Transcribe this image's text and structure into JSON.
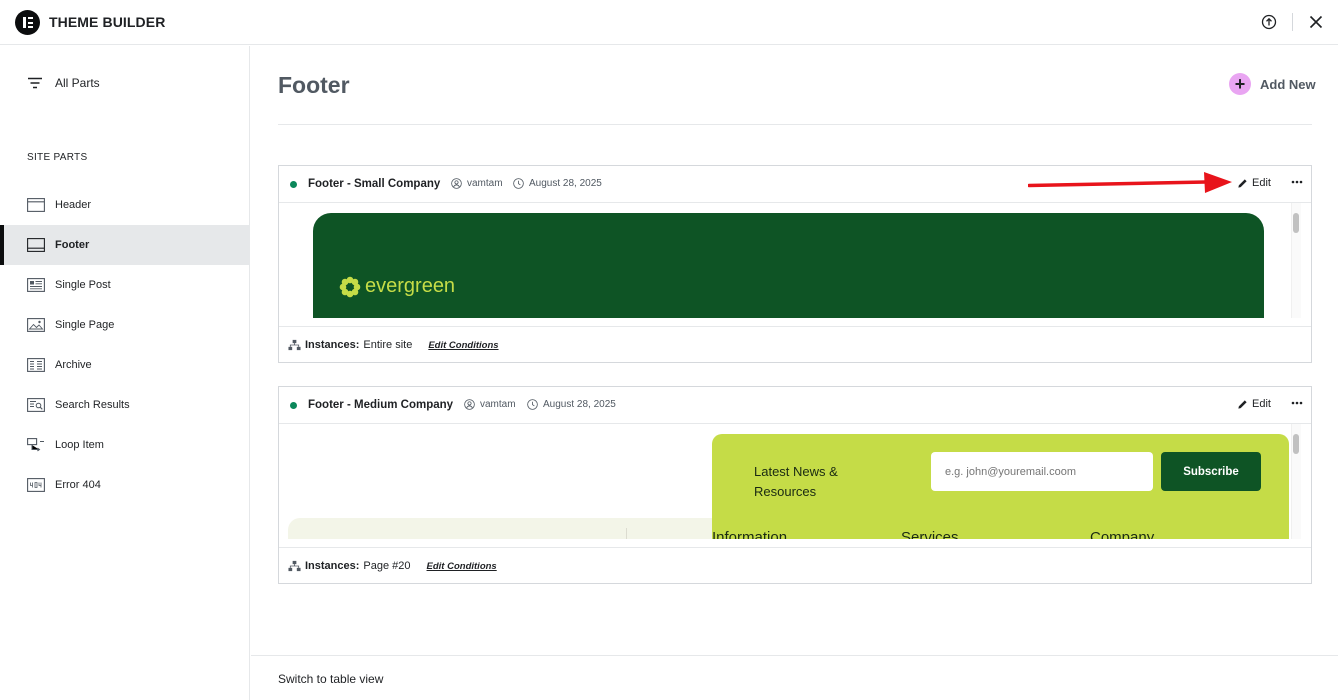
{
  "app": {
    "title": "THEME BUILDER"
  },
  "sidebar": {
    "all_parts": "All Parts",
    "section_label": "SITE PARTS",
    "items": [
      {
        "label": "Header",
        "icon": "header-icon"
      },
      {
        "label": "Footer",
        "icon": "footer-icon",
        "active": true
      },
      {
        "label": "Single Post",
        "icon": "single-post-icon"
      },
      {
        "label": "Single Page",
        "icon": "single-page-icon"
      },
      {
        "label": "Archive",
        "icon": "archive-icon"
      },
      {
        "label": "Search Results",
        "icon": "search-results-icon"
      },
      {
        "label": "Loop Item",
        "icon": "loop-item-icon"
      },
      {
        "label": "Error 404",
        "icon": "error-404-icon"
      }
    ]
  },
  "main": {
    "title": "Footer",
    "add_new": "Add New",
    "switch_view": "Switch to table view"
  },
  "cards": [
    {
      "title": "Footer - Small Company",
      "author": "vamtam",
      "date": "August 28, 2025",
      "edit": "Edit",
      "instances_label": "Instances:",
      "instances_value": "Entire site",
      "edit_conditions": "Edit Conditions",
      "preview_brand": "evergreen"
    },
    {
      "title": "Footer - Medium Company",
      "author": "vamtam",
      "date": "August 28, 2025",
      "edit": "Edit",
      "instances_label": "Instances:",
      "instances_value": "Page #20",
      "edit_conditions": "Edit Conditions",
      "preview_news": "Latest News & Resources",
      "preview_email_placeholder": "e.g. john@youremail.coom",
      "preview_subscribe": "Subscribe",
      "preview_columns": [
        "Information",
        "Services",
        "Company"
      ]
    }
  ],
  "colors": {
    "status_dot": "#0a875a",
    "brand_green": "#0e5425",
    "brand_lime": "#c5dc47",
    "add_accent": "#e9a5f2",
    "annotation_arrow": "#e8141b"
  }
}
